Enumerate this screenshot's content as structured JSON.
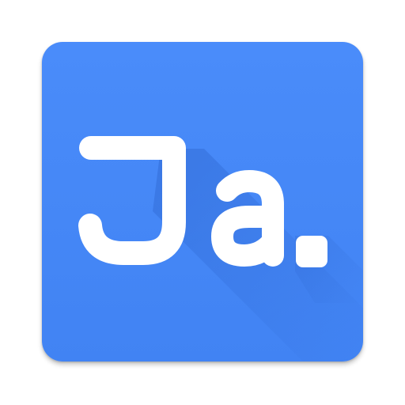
{
  "icon": {
    "symbol": "Ja.",
    "icon_name": "ja-app-icon",
    "colors": {
      "background": "#4488f8",
      "background_edge": "#3f80f2",
      "long_shadow": "#2f6fe0",
      "text": "#ffffff",
      "page": "#ffffff"
    }
  }
}
